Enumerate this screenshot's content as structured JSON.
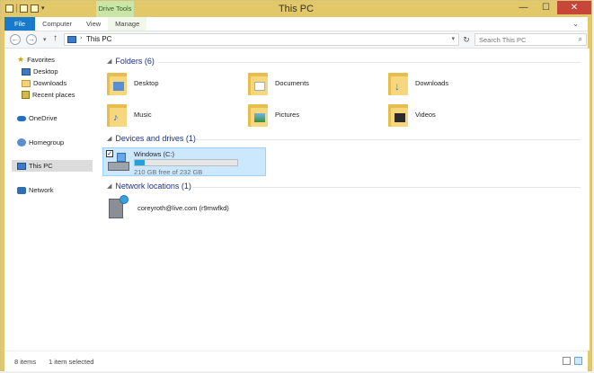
{
  "window": {
    "title": "This PC",
    "contextual_tab": "Drive Tools"
  },
  "ribbon": {
    "tabs": [
      {
        "label": "File"
      },
      {
        "label": "Computer"
      },
      {
        "label": "View"
      },
      {
        "label": "Manage"
      }
    ]
  },
  "address": {
    "location": "This PC",
    "search_placeholder": "Search This PC"
  },
  "nav_pane": {
    "favorites": {
      "label": "Favorites",
      "items": [
        {
          "label": "Desktop"
        },
        {
          "label": "Downloads"
        },
        {
          "label": "Recent places"
        }
      ]
    },
    "onedrive": "OneDrive",
    "homegroup": "Homegroup",
    "thispc": "This PC",
    "network": "Network"
  },
  "folders": {
    "header": "Folders (6)",
    "items": [
      {
        "label": "Desktop",
        "icon": "desktop-folder-icon"
      },
      {
        "label": "Documents",
        "icon": "documents-folder-icon"
      },
      {
        "label": "Downloads",
        "icon": "downloads-folder-icon"
      },
      {
        "label": "Music",
        "icon": "music-folder-icon"
      },
      {
        "label": "Pictures",
        "icon": "pictures-folder-icon"
      },
      {
        "label": "Videos",
        "icon": "videos-folder-icon"
      }
    ]
  },
  "devices": {
    "header": "Devices and drives (1)",
    "drive": {
      "name": "Windows (C:)",
      "free_text": "210 GB free of 232 GB",
      "used_fraction": 0.095
    }
  },
  "network_locations": {
    "header": "Network locations (1)",
    "item": {
      "label": "coreyroth@live.com (r9mwfkd)"
    }
  },
  "status": {
    "items": "8 items",
    "selected": "1 item selected"
  },
  "colors": {
    "title_bar": "#e3c869",
    "accent": "#1979ca",
    "section_header": "#1e3287",
    "selection": "#cce8ff"
  }
}
